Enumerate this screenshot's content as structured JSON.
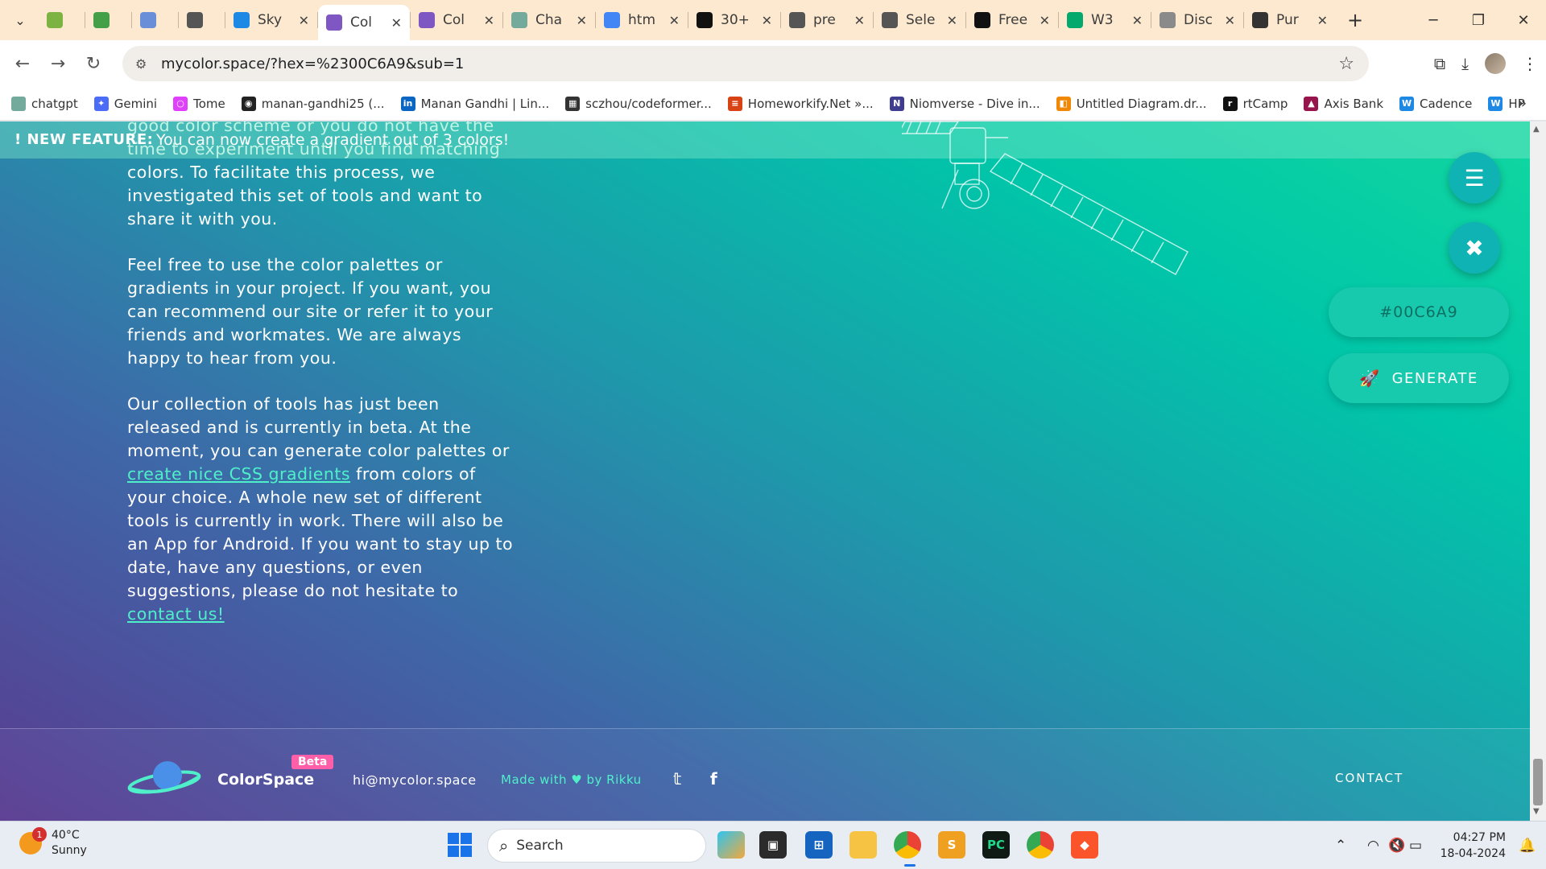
{
  "browser": {
    "tabs": [
      {
        "title": "",
        "icon": "leaf-icon",
        "color": "#7cb342"
      },
      {
        "title": "",
        "icon": "leaf-icon",
        "color": "#43a047"
      },
      {
        "title": "",
        "icon": "browser-icon",
        "color": "#6a8fd8"
      },
      {
        "title": "",
        "icon": "landscape-icon",
        "color": "#555555"
      },
      {
        "title": "Sky",
        "icon": "skype-icon",
        "color": "#1e88e5"
      },
      {
        "title": "Col",
        "icon": "planet-icon",
        "color": "#7e57c2",
        "active": true
      },
      {
        "title": "Col",
        "icon": "planet-icon",
        "color": "#7e57c2"
      },
      {
        "title": "Cha",
        "icon": "chatgpt-icon",
        "color": "#74aa9c"
      },
      {
        "title": "htm",
        "icon": "google-icon",
        "color": "#4285f4"
      },
      {
        "title": "30+",
        "icon": "f-icon",
        "color": "#111111"
      },
      {
        "title": "pre",
        "icon": "globe-icon",
        "color": "#555555"
      },
      {
        "title": "Sele",
        "icon": "globe-icon",
        "color": "#555555"
      },
      {
        "title": "Free",
        "icon": "ff-icon",
        "color": "#111111"
      },
      {
        "title": "W3",
        "icon": "w3-icon",
        "color": "#04aa6d"
      },
      {
        "title": "Disc",
        "icon": "heart-shield-icon",
        "color": "#8a8a8a"
      },
      {
        "title": "Pur",
        "icon": "gear-icon",
        "color": "#333333"
      }
    ],
    "url": "mycolor.space/?hex=%2300C6A9&sub=1",
    "bookmarks": [
      {
        "label": "chatgpt",
        "color": "#74aa9c",
        "glyph": ""
      },
      {
        "label": "Gemini",
        "color": "#4a6cf7",
        "glyph": "✦"
      },
      {
        "label": "Tome",
        "color": "#e040fb",
        "glyph": "○"
      },
      {
        "label": "manan-gandhi25 (...",
        "color": "#222222",
        "glyph": "◉"
      },
      {
        "label": "Manan Gandhi | Lin...",
        "color": "#0a66c2",
        "glyph": "in"
      },
      {
        "label": "sczhou/codeformer...",
        "color": "#333333",
        "glyph": "▦"
      },
      {
        "label": "Homeworkify.Net »...",
        "color": "#d84315",
        "glyph": "≡"
      },
      {
        "label": "Niomverse - Dive in...",
        "color": "#3f3d8f",
        "glyph": "N"
      },
      {
        "label": "Untitled Diagram.dr...",
        "color": "#f08705",
        "glyph": "◧"
      },
      {
        "label": "rtCamp",
        "color": "#111111",
        "glyph": "r"
      },
      {
        "label": "Axis Bank",
        "color": "#97144d",
        "glyph": "▲"
      },
      {
        "label": "Cadence",
        "color": "#1e88e5",
        "glyph": "W"
      },
      {
        "label": "HP",
        "color": "#1e88e5",
        "glyph": "W"
      }
    ]
  },
  "banner": {
    "label": "! NEW FEATURE:",
    "message": "You can now create a gradient out of 3 colors!"
  },
  "article": {
    "p1": "good color scheme or you do not have the time to experiment until you find matching colors. To facilitate this process, we investigated this set of tools and want to share it with you.",
    "p2": "Feel free to use the color palettes or gradients in your project. If you want, you can recommend our site or refer it to your friends and workmates. We are always happy to hear from you.",
    "p3a": "Our collection of tools has just been released and is currently in beta. At the moment, you can generate color palettes or",
    "p3link": "create nice CSS gradients",
    "p3b": "from colors of your choice. A whole new set of different tools is currently in work. There will also be an App for Android. If you want to stay up to date, have any questions, or even suggestions, please do not hesitate to",
    "p3link2": "contact us!"
  },
  "controls": {
    "hex_value": "#00C6A9",
    "generate_label": "GENERATE"
  },
  "footer": {
    "brand": "ColorSpace",
    "beta": "Beta",
    "email": "hi@mycolor.space",
    "made_prefix": "Made with",
    "made_suffix": "by Rikku",
    "contact": "CONTACT"
  },
  "taskbar": {
    "temperature": "40°C",
    "condition": "Sunny",
    "notification_count": "1",
    "search_placeholder": "Search",
    "time": "04:27 PM",
    "date": "18-04-2024"
  },
  "colors": {
    "accent": "#00C6A9",
    "link": "#4FF0C9",
    "beta_badge": "#FF5FA8"
  }
}
